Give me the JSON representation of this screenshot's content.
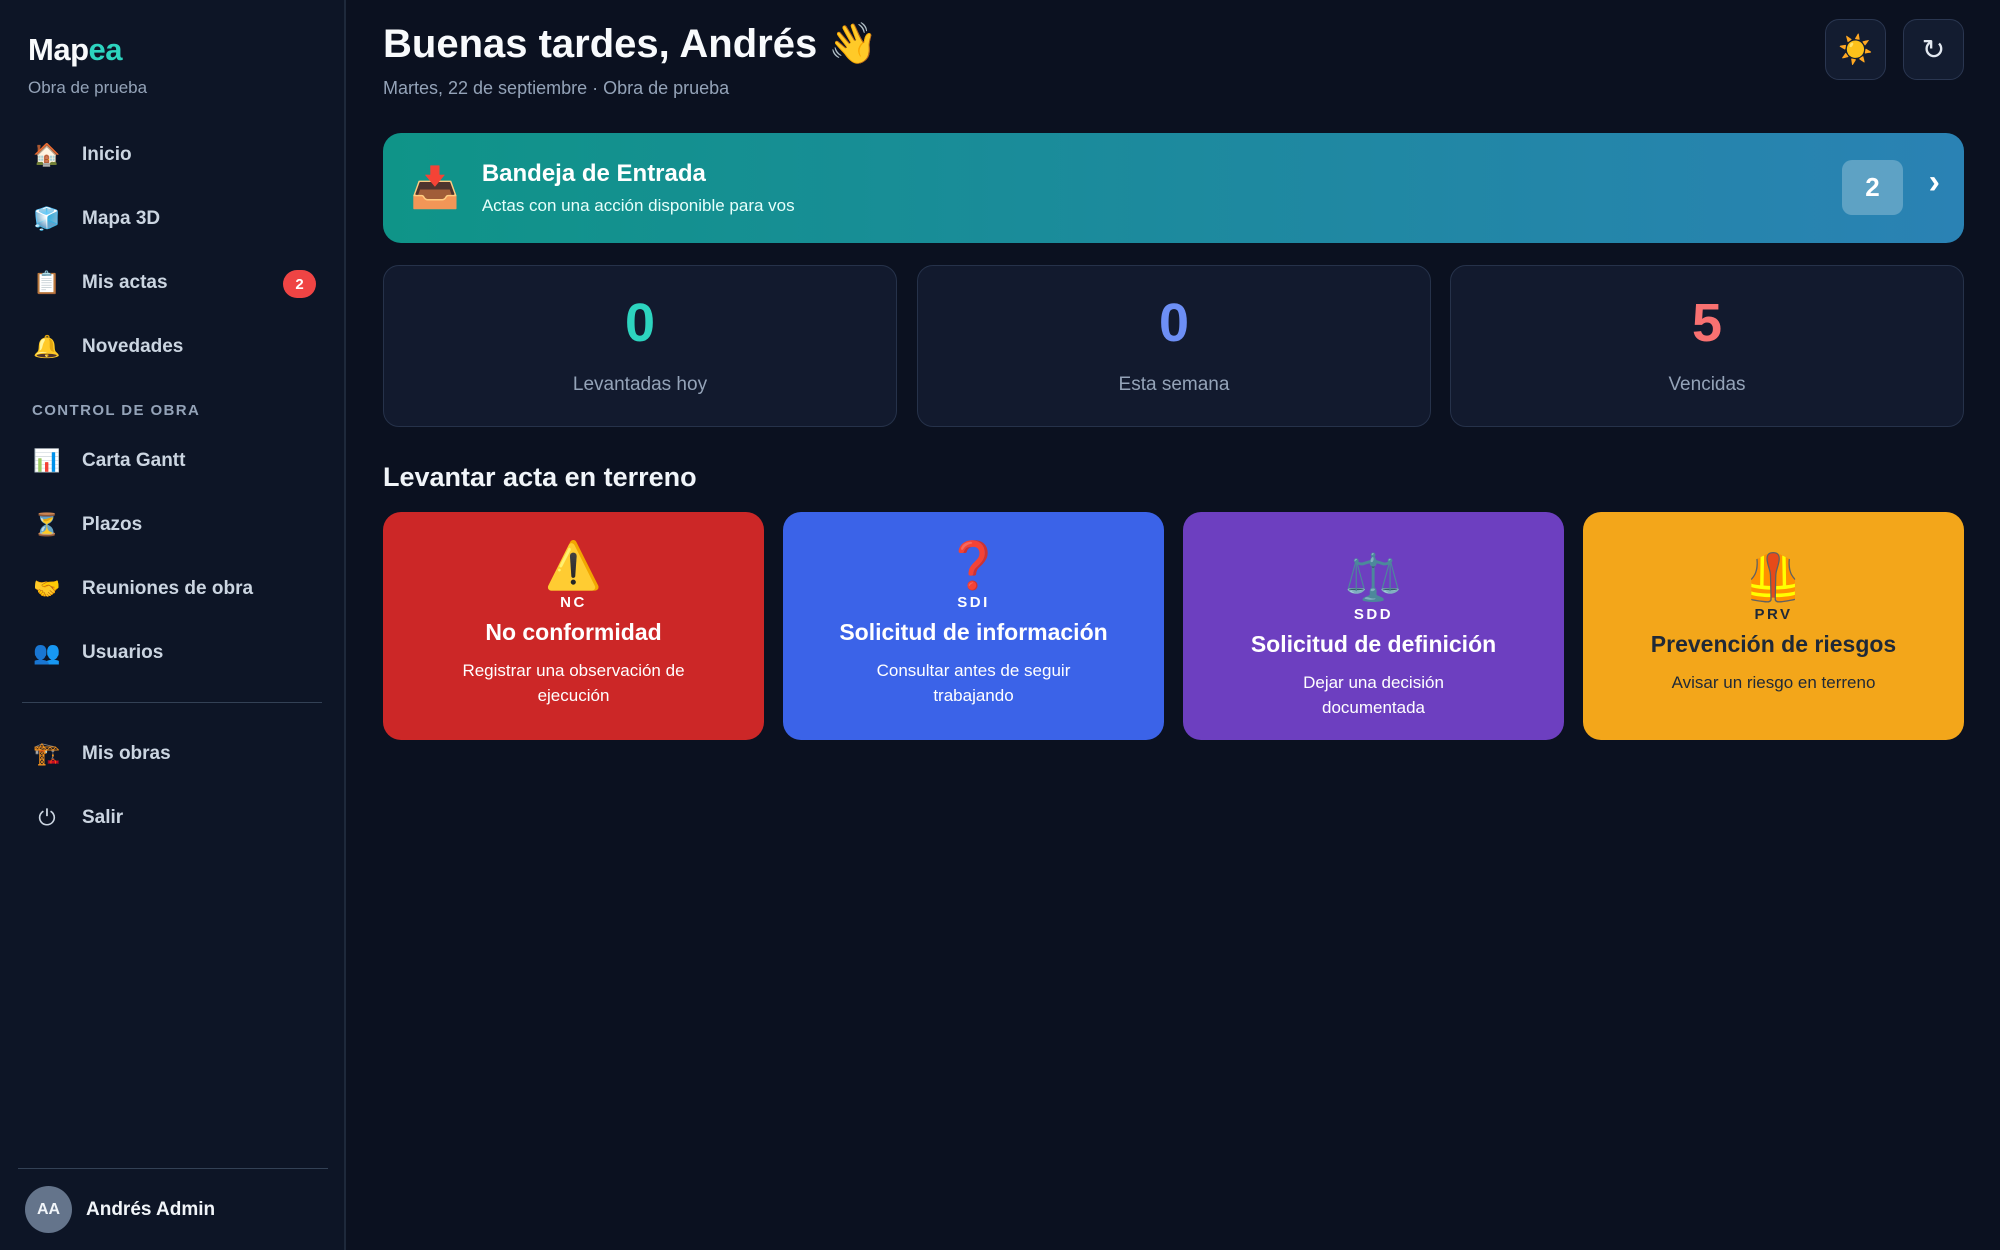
{
  "brand": {
    "name_main": "Map",
    "name_accent": "ea",
    "subtitle": "Obra de prueba"
  },
  "sidebar": {
    "items": [
      {
        "label": "Inicio",
        "icon": "🏠"
      },
      {
        "label": "Mapa 3D",
        "icon": "🧊"
      },
      {
        "label": "Mis actas",
        "icon": "📋",
        "badge": "2"
      },
      {
        "label": "Novedades",
        "icon": "🔔"
      }
    ],
    "section_title": "CONTROL DE OBRA",
    "control_items": [
      {
        "label": "Carta Gantt",
        "icon": "📊"
      },
      {
        "label": "Plazos",
        "icon": "⏳"
      },
      {
        "label": "Reuniones de obra",
        "icon": "🤝"
      },
      {
        "label": "Usuarios",
        "icon": "👥"
      }
    ],
    "bottom_items": [
      {
        "label": "Mis obras",
        "icon": "🏗️"
      },
      {
        "label": "Salir",
        "icon": "⏻"
      }
    ],
    "user": {
      "initials": "AA",
      "name": "Andrés Admin"
    }
  },
  "header": {
    "greeting": "Buenas tardes, Andrés 👋",
    "date_line": "Martes, 22 de septiembre · Obra de prueba",
    "theme_icon": "☀️",
    "refresh_icon": "↻"
  },
  "inbox": {
    "icon": "📥",
    "title": "Bandeja de Entrada",
    "subtitle": "Actas con una acción disponible para vos",
    "count": "2",
    "chevron": "›"
  },
  "stats": [
    {
      "value": "0",
      "label": "Levantadas hoy",
      "color": "#2dd4bf"
    },
    {
      "value": "0",
      "label": "Esta semana",
      "color": "#6d8ff5"
    },
    {
      "value": "5",
      "label": "Vencidas",
      "color": "#f87171"
    }
  ],
  "actions_heading": "Levantar acta en terreno",
  "actions": [
    {
      "icon": "⚠️",
      "code": "NC",
      "title": "No conformidad",
      "desc": "Registrar una observación de ejecución",
      "bg": "#cc2727",
      "fg": "#ffffff"
    },
    {
      "icon": "❓",
      "code": "SDI",
      "title": "Solicitud de información",
      "desc": "Consultar antes de seguir trabajando",
      "bg": "#3b63e8",
      "fg": "#ffffff"
    },
    {
      "icon": "⚖️",
      "code": "SDD",
      "title": "Solicitud de definición",
      "desc": "Dejar una decisión documentada",
      "bg": "#6d3fc0",
      "fg": "#ffffff"
    },
    {
      "icon": "🦺",
      "code": "PRV",
      "title": "Prevención de riesgos",
      "desc": "Avisar un riesgo en terreno",
      "bg": "#f3a61a",
      "fg": "#1f2937"
    }
  ]
}
